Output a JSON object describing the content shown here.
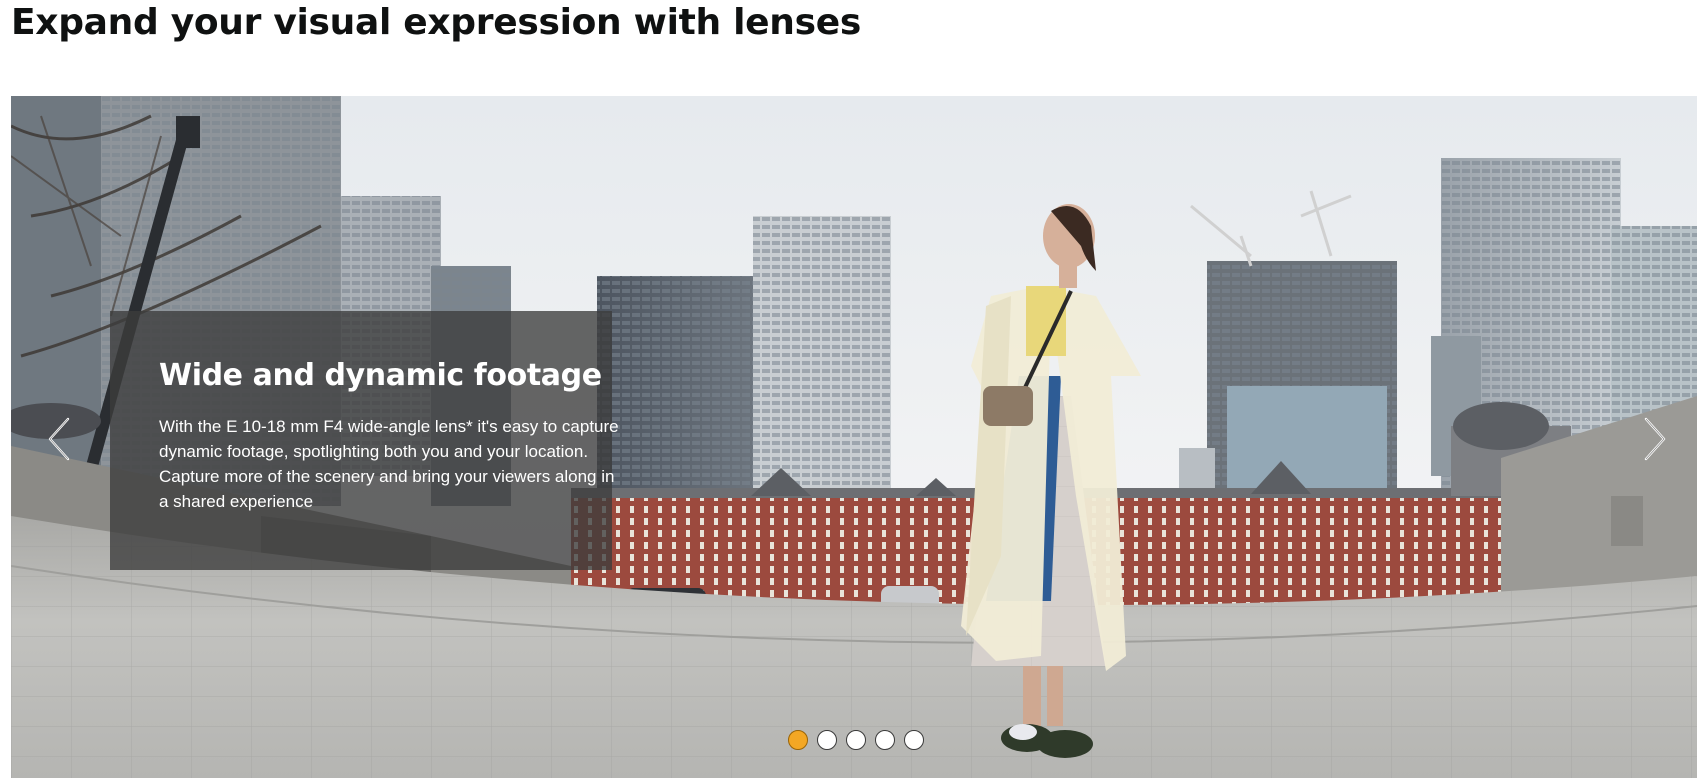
{
  "section": {
    "title": "Expand your visual expression with lenses"
  },
  "carousel": {
    "slide": {
      "heading": "Wide and dynamic footage",
      "body": "With the E 10-18 mm F4 wide-angle lens* it's easy to capture dynamic footage, spotlighting both you and your location. Capture more of the scenery and bring your viewers along in a shared experience"
    },
    "prev_icon": "chevron-left-icon",
    "next_icon": "chevron-right-icon",
    "slide_count": 5,
    "active_slide": 1,
    "colors": {
      "dot_active": "#f3a724",
      "dot_inactive": "#ffffff",
      "caption_bg": "rgba(60,60,60,0.78)"
    }
  }
}
